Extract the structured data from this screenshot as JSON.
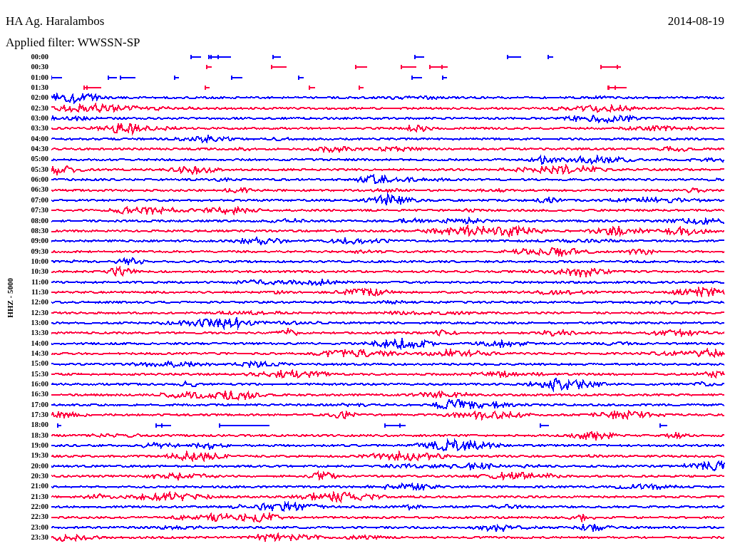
{
  "header": {
    "station": "HA Ag. Haralambos",
    "date": "2014-08-19",
    "filter": "Applied filter: WWSSN-SP"
  },
  "y_axis_label": "HHZ - 5000",
  "rows": [
    {
      "time": "00:00",
      "color": "#0000ff",
      "kind": "gaps"
    },
    {
      "time": "00:30",
      "color": "#ff0040",
      "kind": "gaps"
    },
    {
      "time": "01:00",
      "color": "#0000ff",
      "kind": "gaps"
    },
    {
      "time": "01:30",
      "color": "#ff0040",
      "kind": "gaps"
    },
    {
      "time": "02:00",
      "color": "#0000ff",
      "kind": "trace"
    },
    {
      "time": "02:30",
      "color": "#ff0040",
      "kind": "trace"
    },
    {
      "time": "03:00",
      "color": "#0000ff",
      "kind": "trace"
    },
    {
      "time": "03:30",
      "color": "#ff0040",
      "kind": "trace"
    },
    {
      "time": "04:00",
      "color": "#0000ff",
      "kind": "trace"
    },
    {
      "time": "04:30",
      "color": "#ff0040",
      "kind": "trace"
    },
    {
      "time": "05:00",
      "color": "#0000ff",
      "kind": "trace"
    },
    {
      "time": "05:30",
      "color": "#ff0040",
      "kind": "trace"
    },
    {
      "time": "06:00",
      "color": "#0000ff",
      "kind": "trace"
    },
    {
      "time": "06:30",
      "color": "#ff0040",
      "kind": "trace"
    },
    {
      "time": "07:00",
      "color": "#0000ff",
      "kind": "trace"
    },
    {
      "time": "07:30",
      "color": "#ff0040",
      "kind": "trace"
    },
    {
      "time": "08:00",
      "color": "#0000ff",
      "kind": "trace"
    },
    {
      "time": "08:30",
      "color": "#ff0040",
      "kind": "trace"
    },
    {
      "time": "09:00",
      "color": "#0000ff",
      "kind": "trace"
    },
    {
      "time": "09:30",
      "color": "#ff0040",
      "kind": "trace"
    },
    {
      "time": "10:00",
      "color": "#0000ff",
      "kind": "trace"
    },
    {
      "time": "10:30",
      "color": "#ff0040",
      "kind": "trace"
    },
    {
      "time": "11:00",
      "color": "#0000ff",
      "kind": "trace"
    },
    {
      "time": "11:30",
      "color": "#ff0040",
      "kind": "trace"
    },
    {
      "time": "12:00",
      "color": "#0000ff",
      "kind": "trace"
    },
    {
      "time": "12:30",
      "color": "#ff0040",
      "kind": "trace"
    },
    {
      "time": "13:00",
      "color": "#0000ff",
      "kind": "trace"
    },
    {
      "time": "13:30",
      "color": "#ff0040",
      "kind": "trace"
    },
    {
      "time": "14:00",
      "color": "#0000ff",
      "kind": "trace"
    },
    {
      "time": "14:30",
      "color": "#ff0040",
      "kind": "trace"
    },
    {
      "time": "15:00",
      "color": "#0000ff",
      "kind": "trace"
    },
    {
      "time": "15:30",
      "color": "#ff0040",
      "kind": "trace"
    },
    {
      "time": "16:00",
      "color": "#0000ff",
      "kind": "trace"
    },
    {
      "time": "16:30",
      "color": "#ff0040",
      "kind": "trace"
    },
    {
      "time": "17:00",
      "color": "#0000ff",
      "kind": "trace"
    },
    {
      "time": "17:30",
      "color": "#ff0040",
      "kind": "trace"
    },
    {
      "time": "18:00",
      "color": "#0000ff",
      "kind": "gaps"
    },
    {
      "time": "18:30",
      "color": "#ff0040",
      "kind": "trace"
    },
    {
      "time": "19:00",
      "color": "#0000ff",
      "kind": "trace"
    },
    {
      "time": "19:30",
      "color": "#ff0040",
      "kind": "trace"
    },
    {
      "time": "20:00",
      "color": "#0000ff",
      "kind": "trace"
    },
    {
      "time": "20:30",
      "color": "#ff0040",
      "kind": "trace"
    },
    {
      "time": "21:00",
      "color": "#0000ff",
      "kind": "trace"
    },
    {
      "time": "21:30",
      "color": "#ff0040",
      "kind": "trace"
    },
    {
      "time": "22:00",
      "color": "#0000ff",
      "kind": "trace"
    },
    {
      "time": "22:30",
      "color": "#ff0040",
      "kind": "trace"
    },
    {
      "time": "23:00",
      "color": "#0000ff",
      "kind": "trace"
    },
    {
      "time": "23:30",
      "color": "#ff0040",
      "kind": "trace"
    }
  ]
}
